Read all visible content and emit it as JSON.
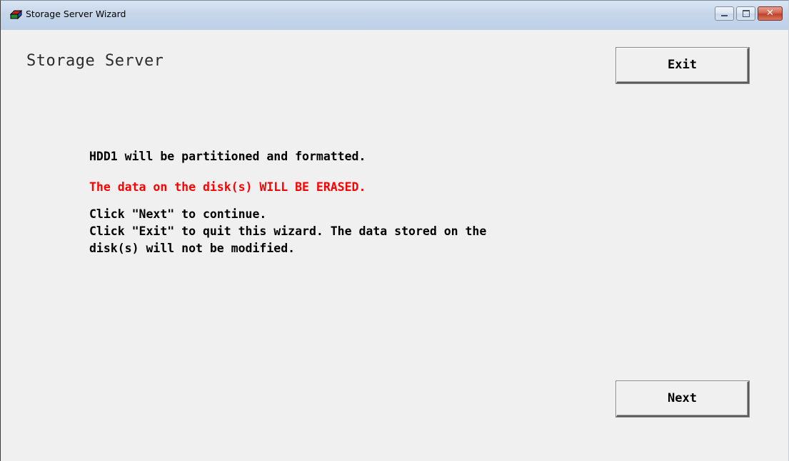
{
  "window": {
    "title": "Storage Server Wizard",
    "icon": "disk-drive-icon"
  },
  "header": {
    "title": "Storage Server"
  },
  "buttons": {
    "exit_label": "Exit",
    "next_label": "Next"
  },
  "message": {
    "line1": "HDD1 will be partitioned and formatted.",
    "warning": "The data on the disk(s) WILL BE ERASED.",
    "line3": "Click \"Next\" to continue.",
    "line4": "Click \"Exit\" to quit this wizard. The data stored on the\ndisk(s) will not be modified."
  },
  "colors": {
    "warning": "#ff0000",
    "background": "#f0f0f0"
  }
}
